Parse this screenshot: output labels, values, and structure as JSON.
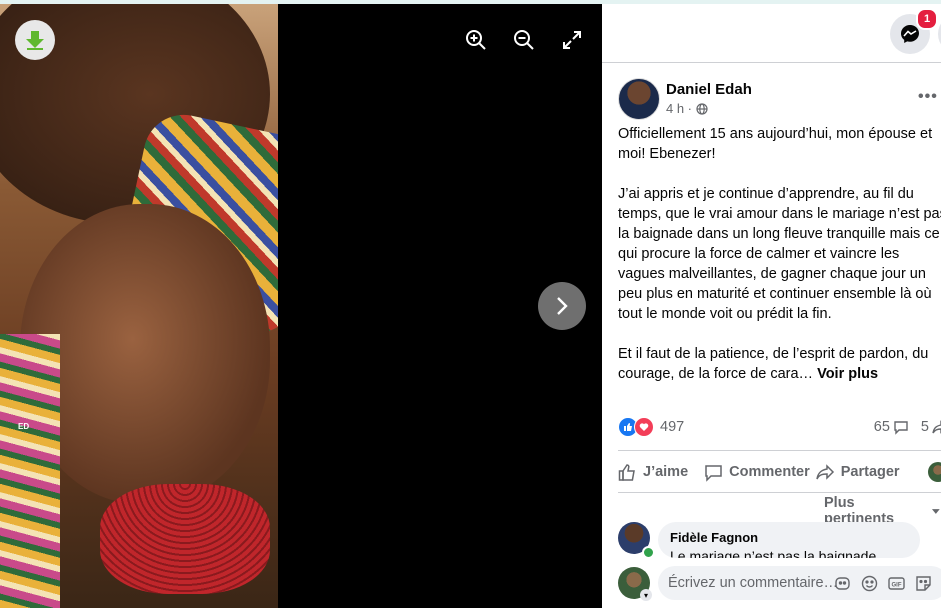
{
  "viewer": {
    "watermark": "ED",
    "icons": {
      "download": "download-icon",
      "zoom_in": "zoom-in-icon",
      "zoom_out": "zoom-out-icon",
      "fullscreen": "fullscreen-icon",
      "next": "chevron-right-icon"
    }
  },
  "header": {
    "messenger_badge": "1"
  },
  "post": {
    "author": "Daniel Edah",
    "time": "4 h ·",
    "paragraphs": [
      "Officiellement 15 ans aujourd’hui, mon épouse et moi! Ebenezer!",
      "J’ai appris et je continue d’apprendre, au fil du temps, que le vrai amour dans le mariage n’est pas la baignade dans un long fleuve tranquille mais ce qui procure la force de calmer et vaincre les vagues malveillantes, de gagner chaque jour un peu plus en maturité et continuer ensemble là où tout le monde voit ou prédit la fin."
    ],
    "truncated": "Et il faut de la patience, de l’esprit de pardon, du courage, de la force de cara…",
    "see_more": "Voir plus"
  },
  "reactions": {
    "count": "497",
    "comments": "65",
    "shares": "5"
  },
  "actions": {
    "like": "J’aime",
    "comment": "Commenter",
    "share": "Partager"
  },
  "comments": {
    "sort_label": "Plus pertinents",
    "items": [
      {
        "author": "Fidèle Fagnon",
        "text": "Le mariage n’est pas la baignade"
      }
    ]
  },
  "composer": {
    "placeholder": "Écrivez un commentaire…"
  },
  "colors": {
    "like_blue": "#1877f2",
    "love_red": "#f33e58",
    "badge_red": "#e41e3f",
    "online_green": "#31a24c"
  }
}
